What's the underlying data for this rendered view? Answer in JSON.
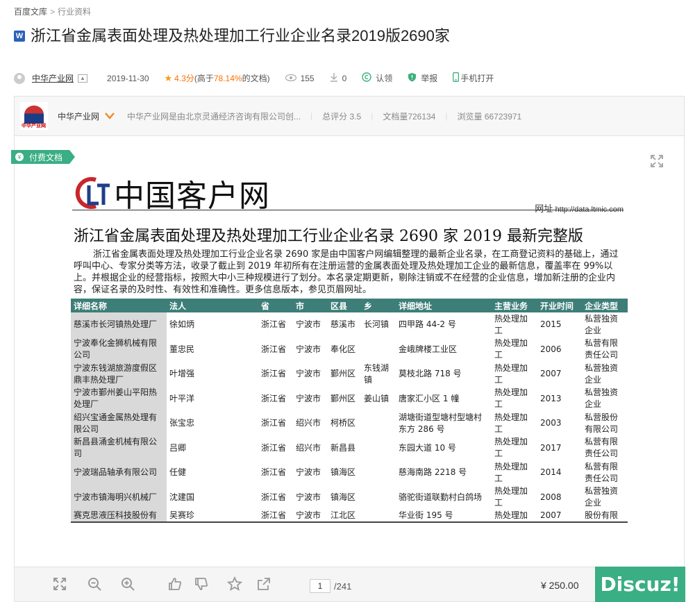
{
  "breadcrumb": {
    "root": "百度文库",
    "sep": ">",
    "current": "行业资料"
  },
  "doc": {
    "icon_letter": "W",
    "title": "浙江省金属表面处理及热处理加工行业企业名录2019版2690家"
  },
  "meta": {
    "author": "中华产业网",
    "date": "2019-11-30",
    "rating": "4.3分",
    "rating_suffix_pre": "(高于",
    "rating_pct": "78.14%",
    "rating_suffix_post": "的文档)",
    "views": "155",
    "downloads": "0",
    "claim": "认领",
    "report": "举报",
    "mobile": "手机打开"
  },
  "author_bar": {
    "logo_text": "中华产业网",
    "name": "中华产业网",
    "desc": "中华产业网是由北京灵通经济咨询有限公司创...",
    "total_score": "总评分 3.5",
    "doc_count": "文档量726134",
    "view_count": "浏览量 66723971"
  },
  "paid_tag": "付费文档",
  "page": {
    "logo_text": "中国客户网",
    "url_label": "网址",
    "url": "http://data.ltmic.com",
    "title": "浙江省金属表面处理及热处理加工行业企业名录 2690 家 2019 最新完整版",
    "intro": "浙江省金属表面处理及热处理加工行业企业名录 2690 家是由中国客户网编辑整理的最新企业名录，在工商登记资料的基础上，通过呼叫中心、专家分类等方法，收录了截止到 2019 年初所有在注册运营的金属表面处理及热处理加工企业的最新信息，覆盖率在 99%以上。并根据企业的经营指标，按照大中小三种规模进行了划分。本名录定期更新，剔除注销或不在经营的企业信息，增加新注册的企业内容，保证名录的及时性、有效性和准确性。更多信息版本，参见页眉网址。"
  },
  "table": {
    "headers": [
      "详细名称",
      "法人",
      "省",
      "市",
      "区县",
      "乡",
      "详细地址",
      "主营业务",
      "开业时间",
      "企业类型"
    ],
    "rows": [
      [
        "慈溪市长河镇热处理厂",
        "徐如炳",
        "浙江省",
        "宁波市",
        "慈溪市",
        "长河镇",
        "四甲路 44-2 号",
        "热处理加工",
        "2015",
        "私营独资企业"
      ],
      [
        "宁波奉化金狮机械有限公司",
        "董忠民",
        "浙江省",
        "宁波市",
        "奉化区",
        "",
        "金峨牌楼工业区",
        "热处理加工",
        "2006",
        "私营有限责任公司"
      ],
      [
        "宁波东钱湖旅游度假区鼎丰热处理厂",
        "叶增强",
        "浙江省",
        "宁波市",
        "鄞州区",
        "东钱湖镇",
        "莫枝北路 718 号",
        "热处理加工",
        "2007",
        "私营独资企业"
      ],
      [
        "宁波市鄞州姜山平阳热处理厂",
        "叶平洋",
        "浙江省",
        "宁波市",
        "鄞州区",
        "姜山镇",
        "唐家汇小区 1 幢",
        "热处理加工",
        "2013",
        "私营独资企业"
      ],
      [
        "绍兴宝通金属热处理有限公司",
        "张宝忠",
        "浙江省",
        "绍兴市",
        "柯桥区",
        "",
        "湖塘街道型塘村型塘村东方 286 号",
        "热处理加工",
        "2003",
        "私营股份有限公司"
      ],
      [
        "新昌县涌金机械有限公司",
        "吕卿",
        "浙江省",
        "绍兴市",
        "新昌县",
        "",
        "东园大道 10 号",
        "热处理加工",
        "2017",
        "私营有限责任公司"
      ],
      [
        "宁波瑞品轴承有限公司",
        "任健",
        "浙江省",
        "宁波市",
        "镇海区",
        "",
        "慈海南路 2218 号",
        "热处理加工",
        "2014",
        "私营有限责任公司"
      ],
      [
        "宁波市镇海明兴机械厂",
        "沈建国",
        "浙江省",
        "宁波市",
        "镇海区",
        "",
        "骆驼街道联勤村白鸽场",
        "热处理加工",
        "2008",
        "私营独资企业"
      ],
      [
        "赛克思液压科技股份有",
        "吴赛珍",
        "浙江省",
        "宁波市",
        "江北区",
        "",
        "华业街 195 号",
        "热处理加",
        "2007",
        "股份有限"
      ]
    ]
  },
  "bottom": {
    "page_current": "1",
    "page_total": "/241",
    "price": "¥ 250.00",
    "buy_label": "Discuz!"
  },
  "colors": {
    "accent": "#3aae84",
    "table_header": "#3d7e78",
    "rating_star": "#f39c12"
  }
}
